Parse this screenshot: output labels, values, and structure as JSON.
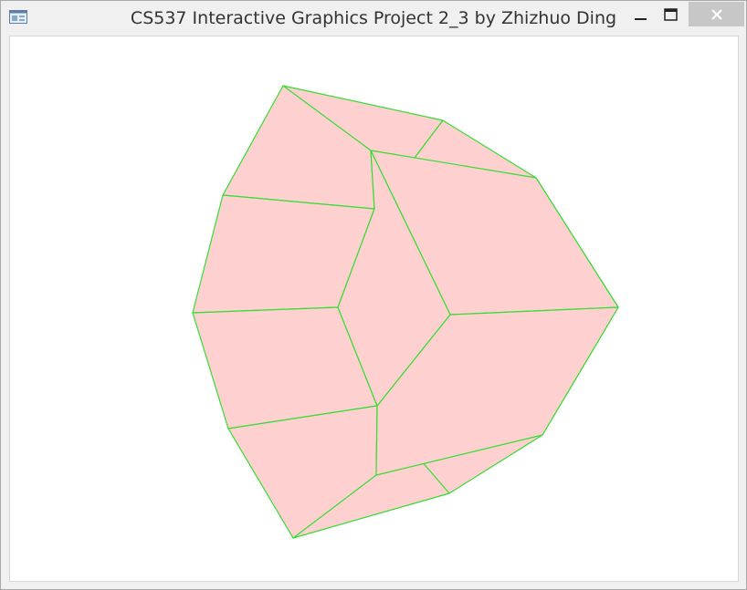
{
  "window": {
    "title": "CS537 Interactive Graphics Project 2_3 by Zhizhuo Ding",
    "icon": "app-window-icon",
    "controls": [
      "minimize-icon",
      "maximize-icon",
      "close-icon"
    ]
  },
  "scene": {
    "shape": "wireframe polyhedron",
    "face_color": "#ffd0d0",
    "edge_color": "#33dd33",
    "background": "#ffffff"
  },
  "colors": {
    "titlebar": "#f0f0f0",
    "close_button_bg": "#c7c7c7",
    "title_text": "#333333"
  }
}
